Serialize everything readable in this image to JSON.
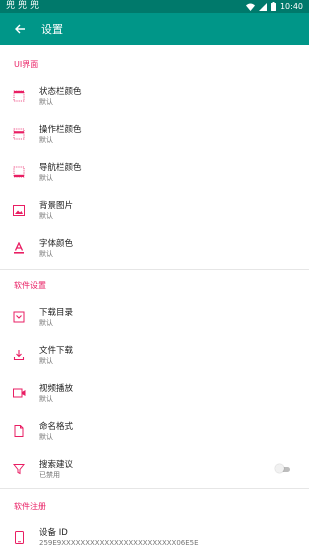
{
  "status_bar": {
    "notifications": [
      "兜",
      "兜",
      "兜"
    ],
    "time": "10:40"
  },
  "toolbar": {
    "title": "设置"
  },
  "colors": {
    "primary": "#009688",
    "primary_dark": "#00796b",
    "accent": "#e91e63"
  },
  "sections": [
    {
      "header": "UI界面",
      "items": [
        {
          "icon": "status-bar-icon",
          "title": "状态栏颜色",
          "summary": "默认"
        },
        {
          "icon": "action-bar-icon",
          "title": "操作栏颜色",
          "summary": "默认"
        },
        {
          "icon": "nav-bar-icon",
          "title": "导航栏颜色",
          "summary": "默认"
        },
        {
          "icon": "image-icon",
          "title": "背景图片",
          "summary": "默认"
        },
        {
          "icon": "font-color-icon",
          "title": "字体颜色",
          "summary": "默认"
        }
      ]
    },
    {
      "header": "软件设置",
      "items": [
        {
          "icon": "folder-download-icon",
          "title": "下载目录",
          "summary": "默认"
        },
        {
          "icon": "download-icon",
          "title": "文件下载",
          "summary": "默认"
        },
        {
          "icon": "video-icon",
          "title": "视频播放",
          "summary": "默认"
        },
        {
          "icon": "file-icon",
          "title": "命名格式",
          "summary": "默认"
        },
        {
          "icon": "filter-icon",
          "title": "搜索建议",
          "summary": "已禁用",
          "switch_on": false
        }
      ]
    },
    {
      "header": "软件注册",
      "items": [
        {
          "icon": "phone-icon",
          "title": "设备 ID",
          "summary": "259E9XXXXXXXXXXXXXXXXXXXXXXXX06E5E"
        }
      ]
    }
  ]
}
